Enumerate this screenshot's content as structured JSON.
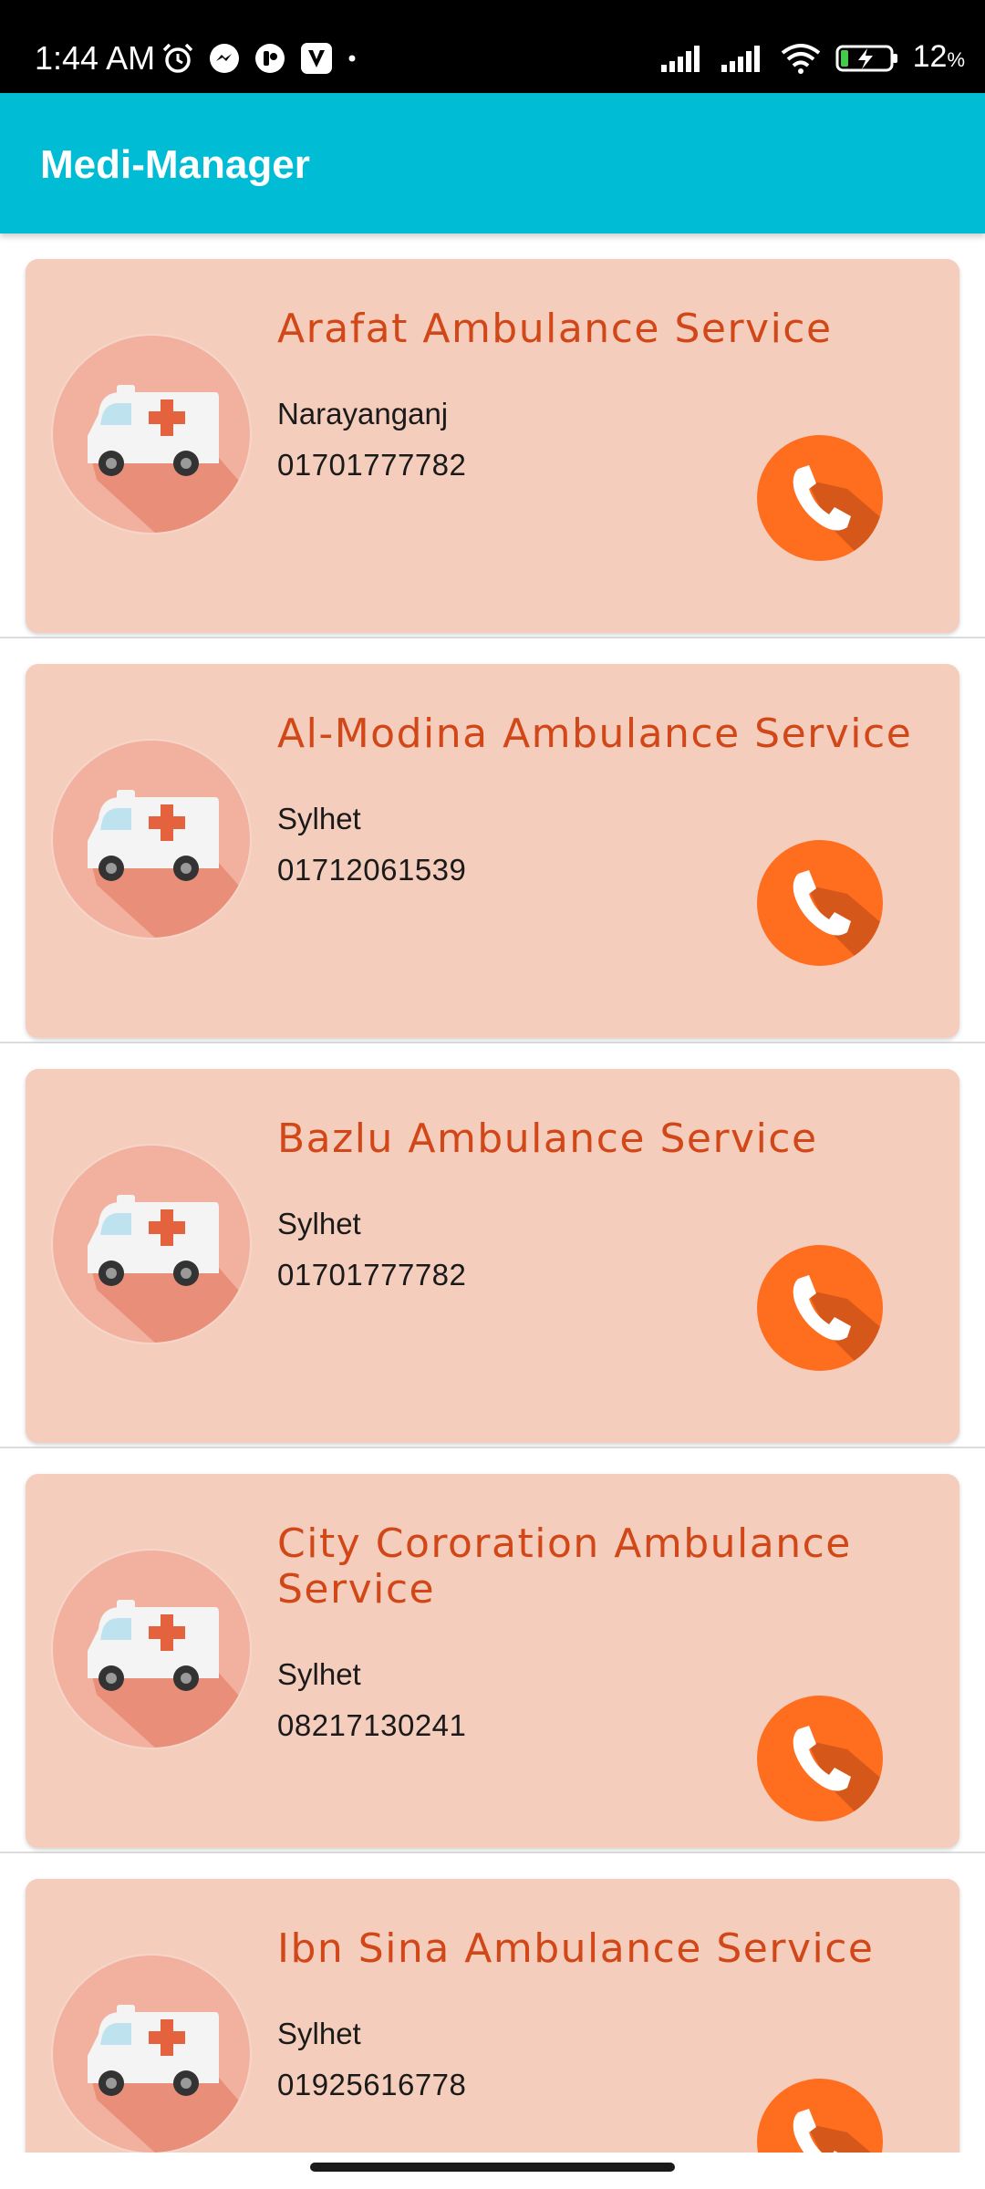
{
  "status_bar": {
    "time": "1:44 AM",
    "battery_percent": "12",
    "battery_unit": "%",
    "icons": [
      "alarm-icon",
      "messenger-icon",
      "notification-app-icon",
      "viber-icon",
      "dot-icon",
      "signal-icon",
      "signal-icon",
      "wifi-icon",
      "battery-charging-icon"
    ]
  },
  "app_bar": {
    "title": "Medi-Manager",
    "color": "#00BCD4"
  },
  "colors": {
    "card_bg": "#F4CDBC",
    "title": "#D24718",
    "call_button": "#FF6D1F"
  },
  "services": [
    {
      "name": "Arafat Ambulance Service",
      "city": "Narayanganj",
      "phone": "01701777782"
    },
    {
      "name": "Al-Modina Ambulance Service",
      "city": "Sylhet",
      "phone": "01712061539"
    },
    {
      "name": "Bazlu Ambulance Service",
      "city": "Sylhet",
      "phone": "01701777782"
    },
    {
      "name": "City Cororation Ambulance Service",
      "city": "Sylhet",
      "phone": "08217130241"
    },
    {
      "name": "Ibn Sina Ambulance Service",
      "city": "Sylhet",
      "phone": "01925616778"
    }
  ]
}
